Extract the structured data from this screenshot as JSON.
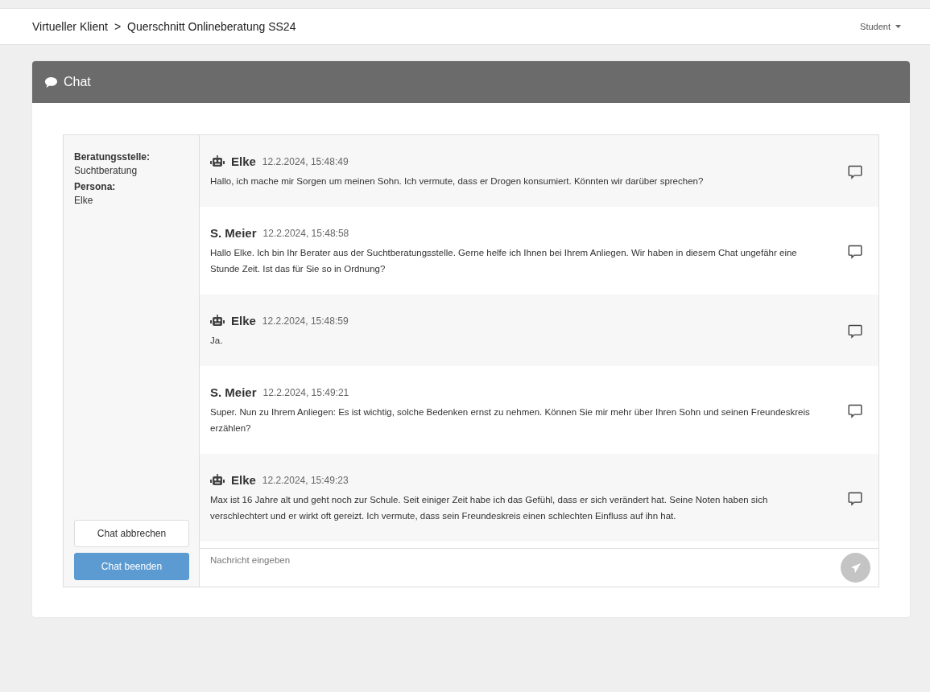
{
  "navbar": {
    "breadcrumb": [
      "Virtueller Klient",
      ">",
      "Querschnitt Onlineberatung SS24"
    ],
    "user_menu": "Student"
  },
  "card": {
    "title": "Chat"
  },
  "sidebar": {
    "fields": [
      {
        "label": "Beratungsstelle:",
        "value": "Suchtberatung"
      },
      {
        "label": "Persona:",
        "value": "Elke"
      }
    ],
    "buttons": [
      {
        "label": "Chat abbrechen",
        "kind": "default"
      },
      {
        "label": "Chat beenden",
        "kind": "primary"
      }
    ]
  },
  "messages": [
    {
      "kind": "bot",
      "sender": "Elke",
      "time": "12.2.2024, 15:48:49",
      "text": "Hallo, ich mache mir Sorgen um meinen Sohn. Ich vermute, dass er Drogen konsumiert. Könnten wir darüber sprechen?"
    },
    {
      "kind": "human",
      "sender": "S. Meier",
      "time": "12.2.2024, 15:48:58",
      "text": "Hallo Elke. Ich bin Ihr Berater aus der Suchtberatungsstelle. Gerne helfe ich Ihnen bei Ihrem Anliegen. Wir haben in diesem Chat ungefähr eine Stunde Zeit. Ist das für Sie so in Ordnung?"
    },
    {
      "kind": "bot",
      "sender": "Elke",
      "time": "12.2.2024, 15:48:59",
      "text": "Ja."
    },
    {
      "kind": "human",
      "sender": "S. Meier",
      "time": "12.2.2024, 15:49:21",
      "text": "Super. Nun zu Ihrem Anliegen: Es ist wichtig, solche Bedenken ernst zu nehmen. Können Sie mir mehr über Ihren Sohn und seinen Freundeskreis erzählen?"
    },
    {
      "kind": "bot",
      "sender": "Elke",
      "time": "12.2.2024, 15:49:23",
      "text": "Max ist 16 Jahre alt und geht noch zur Schule. Seit einiger Zeit habe ich das Gefühl, dass er sich verändert hat. Seine Noten haben sich verschlechtert und er wirkt oft gereizt. Ich vermute, dass sein Freundeskreis einen schlechten Einfluss auf ihn hat."
    }
  ],
  "composer": {
    "placeholder": "Nachricht eingeben",
    "send_disabled": true
  }
}
